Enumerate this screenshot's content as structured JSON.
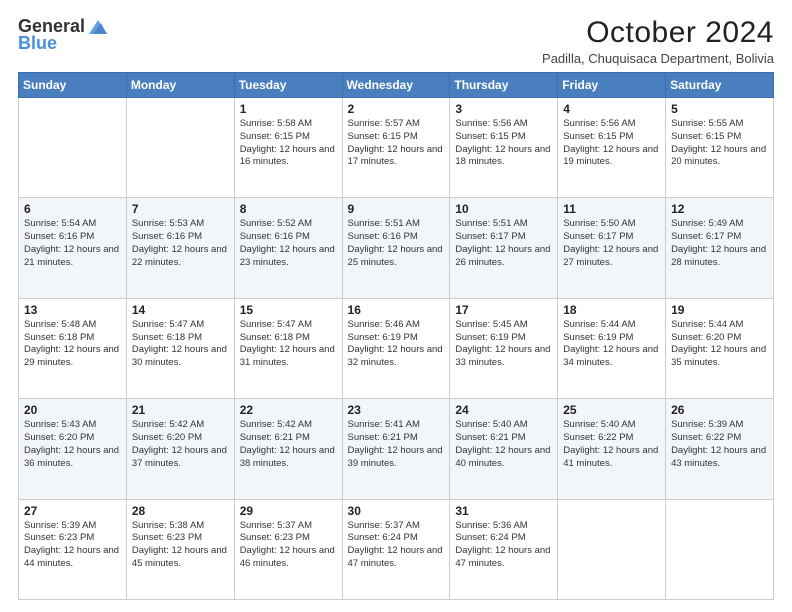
{
  "logo": {
    "line1": "General",
    "line2": "Blue"
  },
  "title": "October 2024",
  "subtitle": "Padilla, Chuquisaca Department, Bolivia",
  "days_of_week": [
    "Sunday",
    "Monday",
    "Tuesday",
    "Wednesday",
    "Thursday",
    "Friday",
    "Saturday"
  ],
  "weeks": [
    [
      {
        "day": "",
        "info": ""
      },
      {
        "day": "",
        "info": ""
      },
      {
        "day": "1",
        "info": "Sunrise: 5:58 AM\nSunset: 6:15 PM\nDaylight: 12 hours and 16 minutes."
      },
      {
        "day": "2",
        "info": "Sunrise: 5:57 AM\nSunset: 6:15 PM\nDaylight: 12 hours and 17 minutes."
      },
      {
        "day": "3",
        "info": "Sunrise: 5:56 AM\nSunset: 6:15 PM\nDaylight: 12 hours and 18 minutes."
      },
      {
        "day": "4",
        "info": "Sunrise: 5:56 AM\nSunset: 6:15 PM\nDaylight: 12 hours and 19 minutes."
      },
      {
        "day": "5",
        "info": "Sunrise: 5:55 AM\nSunset: 6:15 PM\nDaylight: 12 hours and 20 minutes."
      }
    ],
    [
      {
        "day": "6",
        "info": "Sunrise: 5:54 AM\nSunset: 6:16 PM\nDaylight: 12 hours and 21 minutes."
      },
      {
        "day": "7",
        "info": "Sunrise: 5:53 AM\nSunset: 6:16 PM\nDaylight: 12 hours and 22 minutes."
      },
      {
        "day": "8",
        "info": "Sunrise: 5:52 AM\nSunset: 6:16 PM\nDaylight: 12 hours and 23 minutes."
      },
      {
        "day": "9",
        "info": "Sunrise: 5:51 AM\nSunset: 6:16 PM\nDaylight: 12 hours and 25 minutes."
      },
      {
        "day": "10",
        "info": "Sunrise: 5:51 AM\nSunset: 6:17 PM\nDaylight: 12 hours and 26 minutes."
      },
      {
        "day": "11",
        "info": "Sunrise: 5:50 AM\nSunset: 6:17 PM\nDaylight: 12 hours and 27 minutes."
      },
      {
        "day": "12",
        "info": "Sunrise: 5:49 AM\nSunset: 6:17 PM\nDaylight: 12 hours and 28 minutes."
      }
    ],
    [
      {
        "day": "13",
        "info": "Sunrise: 5:48 AM\nSunset: 6:18 PM\nDaylight: 12 hours and 29 minutes."
      },
      {
        "day": "14",
        "info": "Sunrise: 5:47 AM\nSunset: 6:18 PM\nDaylight: 12 hours and 30 minutes."
      },
      {
        "day": "15",
        "info": "Sunrise: 5:47 AM\nSunset: 6:18 PM\nDaylight: 12 hours and 31 minutes."
      },
      {
        "day": "16",
        "info": "Sunrise: 5:46 AM\nSunset: 6:19 PM\nDaylight: 12 hours and 32 minutes."
      },
      {
        "day": "17",
        "info": "Sunrise: 5:45 AM\nSunset: 6:19 PM\nDaylight: 12 hours and 33 minutes."
      },
      {
        "day": "18",
        "info": "Sunrise: 5:44 AM\nSunset: 6:19 PM\nDaylight: 12 hours and 34 minutes."
      },
      {
        "day": "19",
        "info": "Sunrise: 5:44 AM\nSunset: 6:20 PM\nDaylight: 12 hours and 35 minutes."
      }
    ],
    [
      {
        "day": "20",
        "info": "Sunrise: 5:43 AM\nSunset: 6:20 PM\nDaylight: 12 hours and 36 minutes."
      },
      {
        "day": "21",
        "info": "Sunrise: 5:42 AM\nSunset: 6:20 PM\nDaylight: 12 hours and 37 minutes."
      },
      {
        "day": "22",
        "info": "Sunrise: 5:42 AM\nSunset: 6:21 PM\nDaylight: 12 hours and 38 minutes."
      },
      {
        "day": "23",
        "info": "Sunrise: 5:41 AM\nSunset: 6:21 PM\nDaylight: 12 hours and 39 minutes."
      },
      {
        "day": "24",
        "info": "Sunrise: 5:40 AM\nSunset: 6:21 PM\nDaylight: 12 hours and 40 minutes."
      },
      {
        "day": "25",
        "info": "Sunrise: 5:40 AM\nSunset: 6:22 PM\nDaylight: 12 hours and 41 minutes."
      },
      {
        "day": "26",
        "info": "Sunrise: 5:39 AM\nSunset: 6:22 PM\nDaylight: 12 hours and 43 minutes."
      }
    ],
    [
      {
        "day": "27",
        "info": "Sunrise: 5:39 AM\nSunset: 6:23 PM\nDaylight: 12 hours and 44 minutes."
      },
      {
        "day": "28",
        "info": "Sunrise: 5:38 AM\nSunset: 6:23 PM\nDaylight: 12 hours and 45 minutes."
      },
      {
        "day": "29",
        "info": "Sunrise: 5:37 AM\nSunset: 6:23 PM\nDaylight: 12 hours and 46 minutes."
      },
      {
        "day": "30",
        "info": "Sunrise: 5:37 AM\nSunset: 6:24 PM\nDaylight: 12 hours and 47 minutes."
      },
      {
        "day": "31",
        "info": "Sunrise: 5:36 AM\nSunset: 6:24 PM\nDaylight: 12 hours and 47 minutes."
      },
      {
        "day": "",
        "info": ""
      },
      {
        "day": "",
        "info": ""
      }
    ]
  ]
}
